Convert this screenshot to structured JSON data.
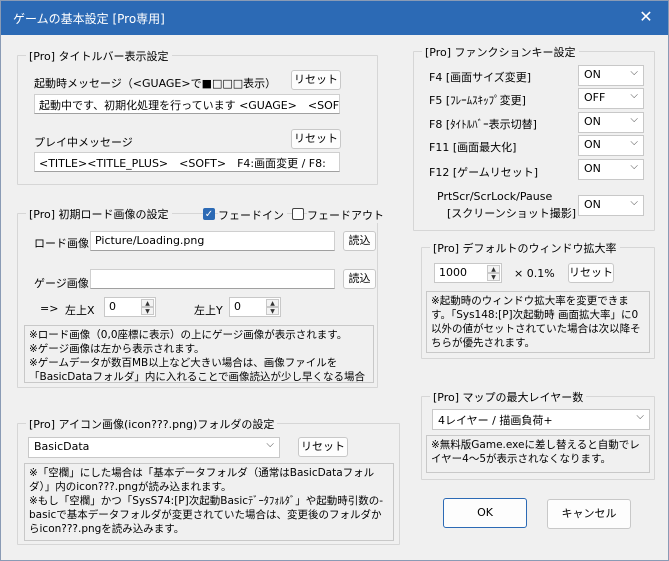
{
  "window": {
    "title": "ゲームの基本設定 [Pro専用]"
  },
  "title_section": {
    "legend": "[Pro] タイトルバー表示設定",
    "startup_label": "起動時メッセージ（<GUAGE>で■□□□表示）",
    "startup_value": "起動中です、初期化処理を行っています <GUAGE>　<SOFT>",
    "playing_label": "プレイ中メッセージ",
    "playing_value": "<TITLE><TITLE_PLUS>　<SOFT>　F4:画面変更 / F8:",
    "reset_label": "リセット"
  },
  "loading_section": {
    "legend": "[Pro] 初期ロード画像の設定",
    "fade_in_label": "フェードイン",
    "fade_in_checked": true,
    "fade_out_label": "フェードアウト",
    "fade_out_checked": false,
    "load_image_label": "ロード画像",
    "load_image_value": "Picture/Loading.png",
    "gauge_image_label": "ゲージ画像",
    "gauge_image_value": "",
    "browse_label": "読込",
    "arrow_label": "=>",
    "x_label": "左上X",
    "x_value": "0",
    "y_label": "左上Y",
    "y_value": "0",
    "note": "※ロード画像（0,0座標に表示）の上にゲージ画像が表示されます。\n※ゲージ画像は左から表示されます。\n※ゲームデータが数百MB以上など大きい場合は、画像ファイルを「BasicDataフォルダ」内に入れることで画像読込が少し早くなる場合があります。"
  },
  "icon_section": {
    "legend": "[Pro] アイコン画像(icon???.png)フォルダの設定",
    "folder_value": "BasicData",
    "reset_label": "リセット",
    "note": "※「空欄」にした場合は「基本データフォルダ（通常はBasicDataフォルダ）」内のicon???.pngが読み込まれます。\n※もし「空欄」かつ「SysS74:[P]次起動Basicﾃﾞｰﾀﾌｫﾙﾀﾞ」や起動時引数の-basicで基本データフォルダが変更されていた場合は、変更後のフォルダからicon???.pngを読み込みます。"
  },
  "function_keys": {
    "legend": "[Pro] ファンクションキー設定",
    "rows": [
      {
        "label": "F4 [画面サイズ変更]",
        "value": "ON"
      },
      {
        "label": "F5 [ﾌﾚｰﾑｽｷｯﾌﾟ変更]",
        "value": "OFF"
      },
      {
        "label": "F8 [ﾀｲﾄﾙﾊﾞｰ表示切替]",
        "value": "ON"
      },
      {
        "label": "F11 [画面最大化]",
        "value": "ON"
      },
      {
        "label": "F12 [ゲームリセット]",
        "value": "ON"
      }
    ],
    "prtscr_label_1": "PrtScr/ScrLock/Pause",
    "prtscr_label_2": "[スクリーンショット撮影]",
    "prtscr_value": "ON"
  },
  "zoom_section": {
    "legend": "[Pro] デフォルトのウィンドウ拡大率",
    "value": "1000",
    "unit": "× 0.1%",
    "reset_label": "リセット",
    "note": "※起動時のウィンドウ拡大率を変更できます。「Sys148:[P]次起動時 画面拡大率」に0以外の値がセットされていた場合は次以降そちらが優先されます。"
  },
  "layer_section": {
    "legend": "[Pro] マップの最大レイヤー数",
    "value": "4レイヤー / 描画負荷+",
    "note": "※無料版Game.exeに差し替えると自動でレイヤー4～5が表示されなくなります。"
  },
  "buttons": {
    "ok": "OK",
    "cancel": "キャンセル"
  }
}
